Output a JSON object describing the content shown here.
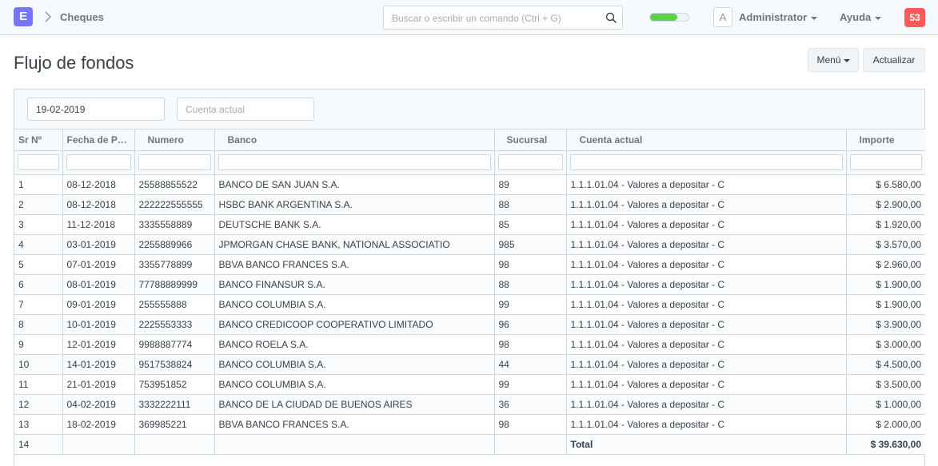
{
  "navbar": {
    "brand_letter": "E",
    "breadcrumb": "Cheques",
    "search_placeholder": "Buscar o escribir un comando (Ctrl + G)",
    "progress_fraction": 0.7,
    "avatar_letter": "A",
    "user_label": "Administrator",
    "help_label": "Ayuda",
    "notification_count": "53"
  },
  "page": {
    "title": "Flujo de fondos",
    "menu_button": "Menú",
    "refresh_button": "Actualizar"
  },
  "filters": {
    "date_value": "19-02-2019",
    "account_placeholder": "Cuenta actual"
  },
  "grid": {
    "columns": [
      "Sr Nº",
      "Fecha de Pago",
      "Numero",
      "Banco",
      "Sucursal",
      "Cuenta actual",
      "Importe"
    ],
    "rows": [
      [
        "1",
        "08-12-2018",
        "25588855522",
        "BANCO DE SAN JUAN S.A.",
        "89",
        "1.1.1.01.04 - Valores a depositar - C",
        "$ 6.580,00"
      ],
      [
        "2",
        "08-12-2018",
        "222222555555",
        "HSBC BANK ARGENTINA S.A.",
        "88",
        "1.1.1.01.04 - Valores a depositar - C",
        "$ 2.900,00"
      ],
      [
        "3",
        "11-12-2018",
        "3335558889",
        "DEUTSCHE BANK S.A.",
        "85",
        "1.1.1.01.04 - Valores a depositar - C",
        "$ 1.920,00"
      ],
      [
        "4",
        "03-01-2019",
        "2255889966",
        "JPMORGAN CHASE BANK, NATIONAL ASSOCIATIO",
        "985",
        "1.1.1.01.04 - Valores a depositar - C",
        "$ 3.570,00"
      ],
      [
        "5",
        "07-01-2019",
        "3355778899",
        "BBVA BANCO FRANCES S.A.",
        "98",
        "1.1.1.01.04 - Valores a depositar - C",
        "$ 2.960,00"
      ],
      [
        "6",
        "08-01-2019",
        "77788889999",
        "BANCO FINANSUR S.A.",
        "88",
        "1.1.1.01.04 - Valores a depositar - C",
        "$ 1.900,00"
      ],
      [
        "7",
        "09-01-2019",
        "255555888",
        "BANCO COLUMBIA S.A.",
        "99",
        "1.1.1.01.04 - Valores a depositar - C",
        "$ 1.900,00"
      ],
      [
        "8",
        "10-01-2019",
        "2225553333",
        "BANCO CREDICOOP COOPERATIVO LIMITADO",
        "96",
        "1.1.1.01.04 - Valores a depositar - C",
        "$ 3.900,00"
      ],
      [
        "9",
        "12-01-2019",
        "9988887774",
        "BANCO ROELA S.A.",
        "98",
        "1.1.1.01.04 - Valores a depositar - C",
        "$ 3.000,00"
      ],
      [
        "10",
        "14-01-2019",
        "9517538824",
        "BANCO COLUMBIA S.A.",
        "44",
        "1.1.1.01.04 - Valores a depositar - C",
        "$ 4.500,00"
      ],
      [
        "11",
        "21-01-2019",
        "753951852",
        "BANCO COLUMBIA S.A.",
        "99",
        "1.1.1.01.04 - Valores a depositar - C",
        "$ 3.500,00"
      ],
      [
        "12",
        "04-02-2019",
        "3332222111",
        "BANCO DE LA CIUDAD DE BUENOS AIRES",
        "36",
        "1.1.1.01.04 - Valores a depositar - C",
        "$ 1.000,00"
      ],
      [
        "13",
        "18-02-2019",
        "369985221",
        "BBVA BANCO FRANCES S.A.",
        "98",
        "1.1.1.01.04 - Valores a depositar - C",
        "$ 2.000,00"
      ]
    ],
    "total_row": {
      "seq": "14",
      "label": "Total",
      "amount": "$ 39.630,00"
    }
  }
}
